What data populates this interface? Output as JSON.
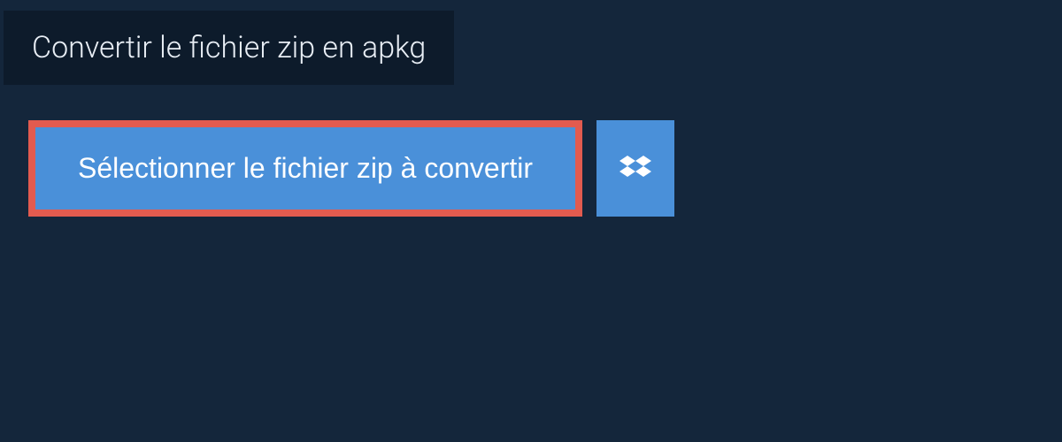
{
  "header": {
    "title": "Convertir le fichier zip en apkg"
  },
  "buttons": {
    "select_file_label": "Sélectionner le fichier zip à convertir",
    "dropbox_label": "Dropbox"
  },
  "colors": {
    "background_dark": "#14263b",
    "header_bg": "#0d1b2b",
    "button_blue": "#4a90d9",
    "highlight_red": "#e25b4f",
    "text_light": "#e8eef5"
  }
}
